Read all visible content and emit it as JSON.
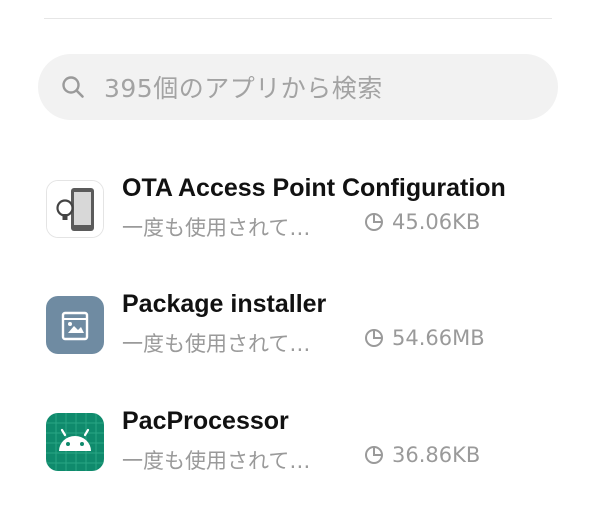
{
  "search": {
    "placeholder": "395個のアプリから検索",
    "icon": "search-icon"
  },
  "apps": [
    {
      "name": "OTA Access Point Configuration",
      "status": "一度も使用されて…",
      "size": "45.06KB",
      "icon": "ota-app-icon",
      "icon_bg": "#ffffff"
    },
    {
      "name": "Package installer",
      "status": "一度も使用されて…",
      "size": "54.66MB",
      "icon": "package-installer-icon",
      "icon_bg": "#6f8ba2"
    },
    {
      "name": "PacProcessor",
      "status": "一度も使用されて…",
      "size": "36.86KB",
      "icon": "android-icon",
      "icon_bg": "#0f8a6c"
    }
  ],
  "colors": {
    "search_bg": "#f2f2f2",
    "placeholder_text": "#a3a3a3",
    "title_text": "#111111",
    "secondary_text": "#9a9a9a"
  }
}
